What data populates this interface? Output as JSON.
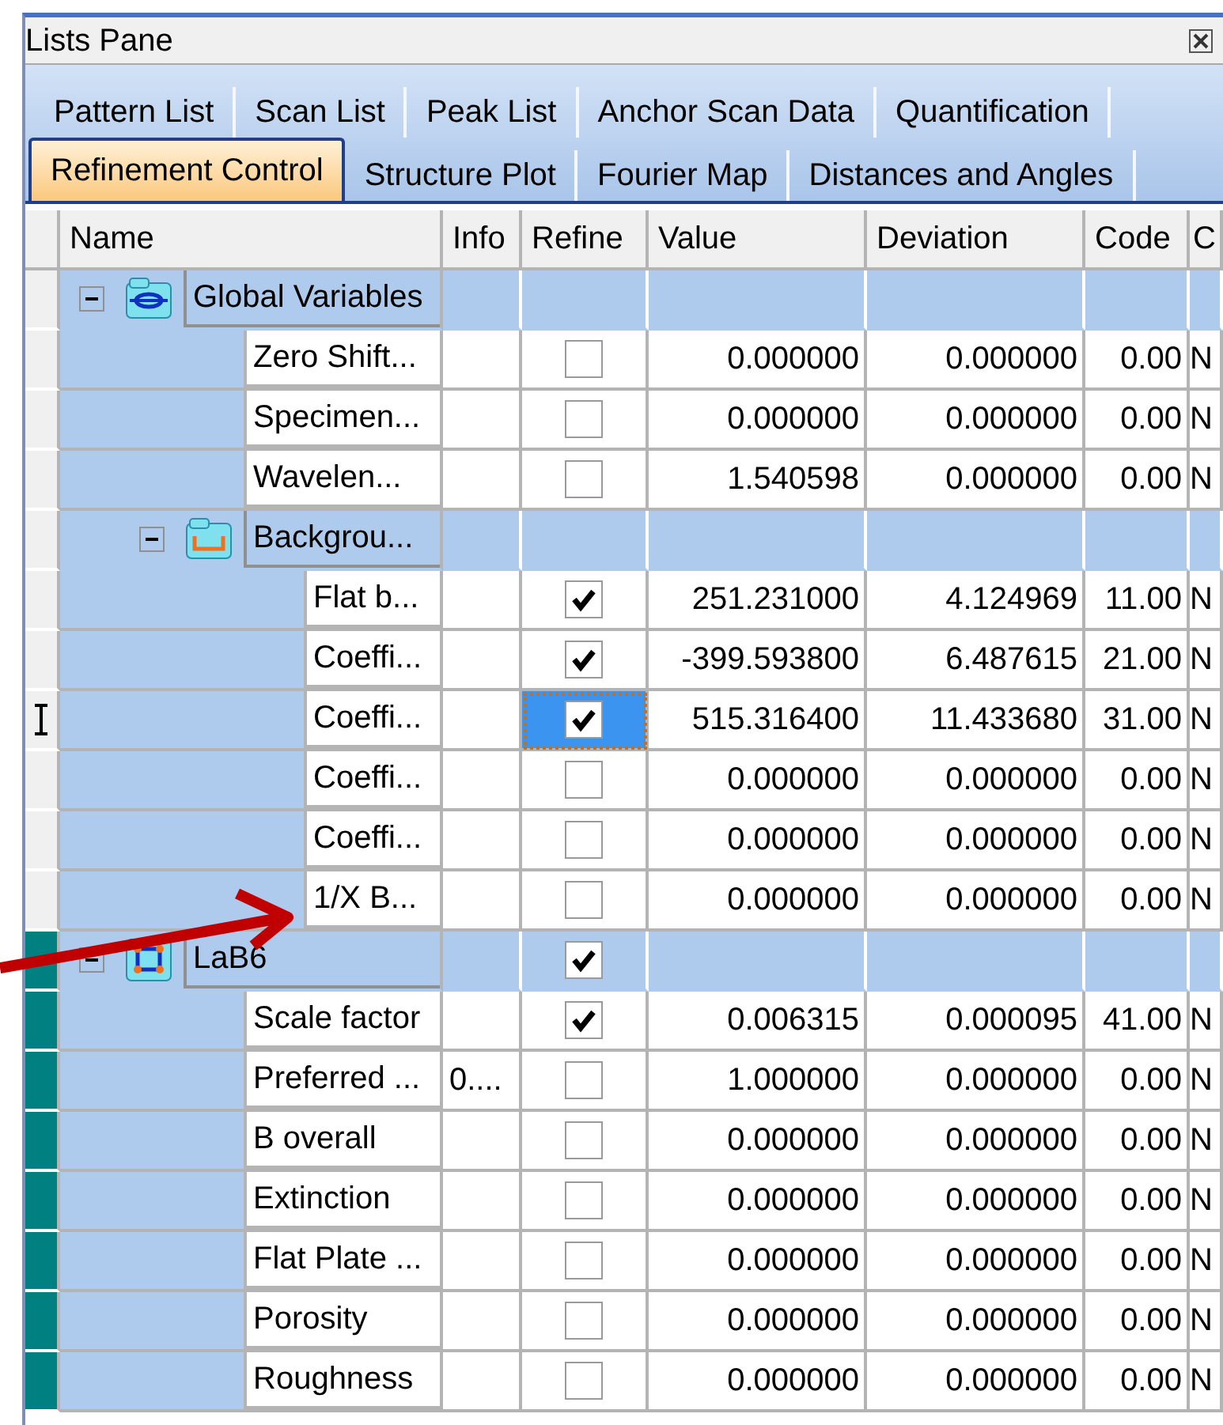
{
  "window": {
    "title": "Lists Pane"
  },
  "tab_rows": [
    {
      "tabs": [
        {
          "label": "Pattern List",
          "selected": false
        },
        {
          "label": "Scan List",
          "selected": false
        },
        {
          "label": "Peak List",
          "selected": false
        },
        {
          "label": "Anchor Scan Data",
          "selected": false
        },
        {
          "label": "Quantification",
          "selected": false
        }
      ]
    },
    {
      "tabs": [
        {
          "label": "Refinement Control",
          "selected": true
        },
        {
          "label": "Structure Plot",
          "selected": false
        },
        {
          "label": "Fourier Map",
          "selected": false
        },
        {
          "label": "Distances and Angles",
          "selected": false
        }
      ]
    }
  ],
  "table": {
    "columns": [
      "Name",
      "Info",
      "Refine",
      "Value",
      "Deviation",
      "Code",
      "C"
    ],
    "tree": [
      {
        "kind": "globals",
        "name": "Global Variables",
        "expanded": true,
        "current": false,
        "children": [
          {
            "kind": "param",
            "name": "Zero Shift...",
            "refine": false,
            "focused": false,
            "value": "0.000000",
            "deviation": "0.000000",
            "code": "0.00",
            "column_7": "N",
            "current": false
          },
          {
            "kind": "param",
            "name": "Specimen...",
            "refine": false,
            "focused": false,
            "value": "0.000000",
            "deviation": "0.000000",
            "code": "0.00",
            "column_7": "N",
            "current": false
          },
          {
            "kind": "param",
            "name": "Wavelen...",
            "refine": false,
            "focused": false,
            "value": "1.540598",
            "deviation": "0.000000",
            "code": "0.00",
            "column_7": "N",
            "current": false
          },
          {
            "kind": "background",
            "name": "Backgrou...",
            "expanded": true,
            "current": false,
            "children": [
              {
                "kind": "param",
                "name": "Flat b...",
                "refine": true,
                "focused": false,
                "value": "251.231000",
                "deviation": "4.124969",
                "code": "11.00",
                "column_7": "N",
                "current": false
              },
              {
                "kind": "param",
                "name": "Coeffi...",
                "refine": true,
                "focused": false,
                "value": "-399.593800",
                "deviation": "6.487615",
                "code": "21.00",
                "column_7": "N",
                "current": false
              },
              {
                "kind": "param",
                "name": "Coeffi...",
                "refine": true,
                "focused": true,
                "value": "515.316400",
                "deviation": "11.433680",
                "code": "31.00",
                "column_7": "N",
                "current": true
              },
              {
                "kind": "param",
                "name": "Coeffi...",
                "refine": false,
                "focused": false,
                "value": "0.000000",
                "deviation": "0.000000",
                "code": "0.00",
                "column_7": "N",
                "current": false
              },
              {
                "kind": "param",
                "name": "Coeffi...",
                "refine": false,
                "focused": false,
                "value": "0.000000",
                "deviation": "0.000000",
                "code": "0.00",
                "column_7": "N",
                "current": false
              },
              {
                "kind": "param",
                "name": "1/X B...",
                "refine": false,
                "focused": false,
                "value": "0.000000",
                "deviation": "0.000000",
                "code": "0.00",
                "column_7": "N",
                "current": false
              }
            ]
          }
        ]
      },
      {
        "kind": "phase",
        "name": "LaB6",
        "expanded": true,
        "refine": true,
        "color": "#008080",
        "current": false,
        "children": [
          {
            "kind": "param",
            "name": "Scale factor",
            "refine": true,
            "focused": false,
            "value": "0.006315",
            "deviation": "0.000095",
            "code": "41.00",
            "column_7": "N",
            "color": "#008080",
            "current": false
          },
          {
            "kind": "param",
            "name": "Preferred ...",
            "info": "0....",
            "refine": false,
            "focused": false,
            "value": "1.000000",
            "deviation": "0.000000",
            "code": "0.00",
            "column_7": "N",
            "color": "#008080",
            "current": false
          },
          {
            "kind": "param",
            "name": "B overall",
            "refine": false,
            "focused": false,
            "value": "0.000000",
            "deviation": "0.000000",
            "code": "0.00",
            "column_7": "N",
            "color": "#008080",
            "current": false
          },
          {
            "kind": "param",
            "name": "Extinction",
            "refine": false,
            "focused": false,
            "value": "0.000000",
            "deviation": "0.000000",
            "code": "0.00",
            "column_7": "N",
            "color": "#008080",
            "current": false
          },
          {
            "kind": "param",
            "name": "Flat Plate ...",
            "refine": false,
            "focused": false,
            "value": "0.000000",
            "deviation": "0.000000",
            "code": "0.00",
            "column_7": "N",
            "color": "#008080",
            "current": false
          },
          {
            "kind": "param",
            "name": "Porosity",
            "refine": false,
            "focused": false,
            "value": "0.000000",
            "deviation": "0.000000",
            "code": "0.00",
            "column_7": "N",
            "color": "#008080",
            "current": false
          },
          {
            "kind": "param",
            "name": "Roughness",
            "refine": false,
            "focused": false,
            "value": "0.000000",
            "deviation": "0.000000",
            "code": "0.00",
            "column_7": "N",
            "color": "#008080",
            "current": false
          }
        ]
      }
    ]
  }
}
